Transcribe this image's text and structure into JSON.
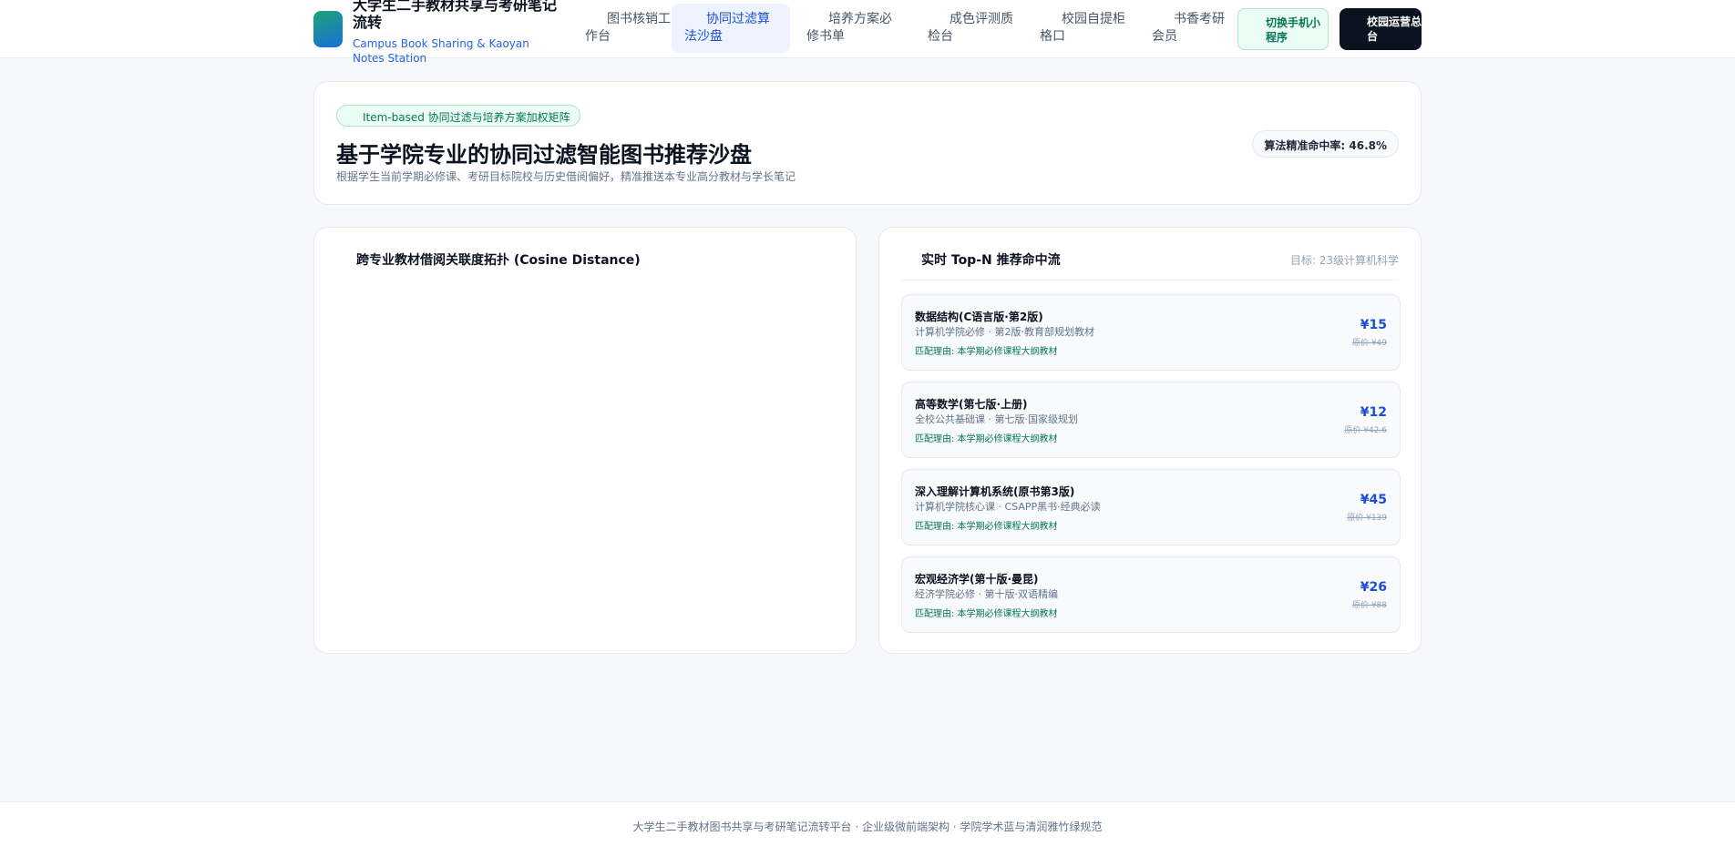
{
  "header": {
    "brand_title": "大学生二手教材共享与考研笔记流转",
    "brand_subtitle": "Campus Book Sharing & Kaoyan Notes Station",
    "nav": [
      {
        "label": "图书核销工作台"
      },
      {
        "label": "协同过滤算法沙盘",
        "active": true
      },
      {
        "label": "培养方案必修书单"
      },
      {
        "label": "成色评测质检台"
      },
      {
        "label": "校园自提柜格口"
      },
      {
        "label": "书香考研会员"
      }
    ],
    "mini_program_label": "切换手机小程序",
    "ops_label": "校园运营总台"
  },
  "hero": {
    "badge": "Item-based 协同过滤与培养方案加权矩阵",
    "title": "基于学院专业的协同过滤智能图书推荐沙盘",
    "description": "根据学生当前学期必修课、考研目标院校与历史借阅偏好，精准推送本专业高分教材与学长笔记",
    "hit_rate": "算法精准命中率: 46.8%"
  },
  "graph_panel": {
    "title": "跨专业教材借阅关联度拓扑 (Cosine Distance)"
  },
  "recs_panel": {
    "title": "实时 Top-N 推荐命中流",
    "target": "目标: 23级计算机科学",
    "items": [
      {
        "title": "数据结构(C语言版·第2版)",
        "meta": "计算机学院必修 · 第2版·教育部规划教材",
        "reason": "匹配理由: 本学期必修课程大纲教材",
        "price": "¥15",
        "original": "原价 ¥49"
      },
      {
        "title": "高等数学(第七版·上册)",
        "meta": "全校公共基础课 · 第七版·国家级规划",
        "reason": "匹配理由: 本学期必修课程大纲教材",
        "price": "¥12",
        "original": "原价 ¥42.6"
      },
      {
        "title": "深入理解计算机系统(原书第3版)",
        "meta": "计算机学院核心课 · CSAPP黑书·经典必读",
        "reason": "匹配理由: 本学期必修课程大纲教材",
        "price": "¥45",
        "original": "原价 ¥139"
      },
      {
        "title": "宏观经济学(第十版·曼昆)",
        "meta": "经济学院必修 · 第十版·双语精编",
        "reason": "匹配理由: 本学期必修课程大纲教材",
        "price": "¥26",
        "original": "原价 ¥88"
      }
    ]
  },
  "footer": {
    "text": "大学生二手教材图书共享与考研笔记流转平台 · 企业级微前端架构 · 学院学术蓝与清润雅竹绿规范"
  }
}
